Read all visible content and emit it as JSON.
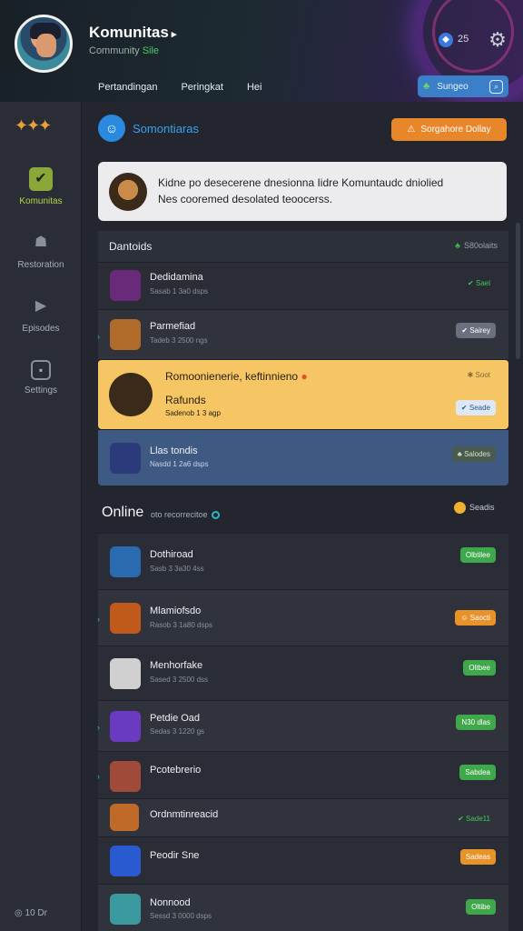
{
  "header": {
    "title": "Komunitas",
    "title_suffix": "▸",
    "subtitle": "Community",
    "subtitle_highlight": "Sile",
    "coin_count": "25",
    "tabs": [
      "Pertandingan",
      "Peringkat",
      "Hei"
    ],
    "search_label": "Sungeo"
  },
  "sidebar": {
    "items": [
      {
        "label": "Komunitas",
        "icon": "check-icon"
      },
      {
        "label": "Restoration",
        "icon": "person-icon"
      },
      {
        "label": "Episodes",
        "icon": "play-icon"
      },
      {
        "label": "Settings",
        "icon": "box-icon"
      }
    ],
    "footer": "10   Dr"
  },
  "community": {
    "title": "Somontiaras",
    "action_label": "Sorgahore Dollay"
  },
  "notice": {
    "line1": "Kidne po desecerene dnesionna Iidre Komuntaudc dniolied",
    "line2": "Nes cooremed desolated teoocerss."
  },
  "featured": {
    "title": "Dantoids",
    "right": "S80olaits",
    "rows": [
      {
        "name": "Dedidamina",
        "meta": "Sasab 1 3a0 dsps",
        "badge": "Sael",
        "badge_style": "green-soft",
        "thumb_color": "#6a2a7a"
      },
      {
        "name": "Parmefiad",
        "meta": "Tadeb 3 2500 ngs",
        "badge": "Sairey",
        "badge_style": "gray",
        "thumb_color": "#b06a2a"
      },
      {
        "name": "Rafunds",
        "title_line": "Romoonienerie, keftinnieno",
        "meta": "Sadenob 1 3 agp",
        "badge": "Seade",
        "badge_style": "light",
        "top_badge": "Soot",
        "thumb_color": "#3a2a1a"
      },
      {
        "name": "Llas tondis",
        "meta": "Nasdd 1 2a6 dsps",
        "badge": "Salodes",
        "badge_style": "dark",
        "thumb_color": "#2a3a7a"
      }
    ]
  },
  "online": {
    "title": "Online",
    "subtitle": "oto recorrecitoe",
    "right": "Seadis",
    "rows": [
      {
        "name": "Dothiroad",
        "meta": "Sasb 3 3a30 4ss",
        "badge": "Olbtilee",
        "badge_style": "green",
        "thumb_color": "#2a6ab0"
      },
      {
        "name": "Mlamiofsdo",
        "meta": "Rasob 3 1a80 dsps",
        "badge": "Saocti",
        "badge_style": "orange",
        "thumb_color": "#c05a1a"
      },
      {
        "name": "Menhorfake",
        "meta": "Sased 3 2500 dss",
        "badge": "Oltbee",
        "badge_style": "green",
        "thumb_color": "#d0d0d0"
      },
      {
        "name": "Petdie Oad",
        "meta": "Sedas 3 1220 gs",
        "badge": "N30 dlas",
        "badge_style": "green",
        "thumb_color": "#6a3ac0"
      },
      {
        "name": "Pcotebrerio",
        "meta": "",
        "badge": "Sabdea",
        "badge_style": "green",
        "thumb_color": "#a04a3a"
      },
      {
        "name": "Ordnmtinreacid",
        "meta": "",
        "badge": "Sade11",
        "badge_style": "green-soft",
        "thumb_color": "#c06a2a"
      },
      {
        "name": "Peodir Sne",
        "meta": "",
        "badge": "Sadeas",
        "badge_style": "orange",
        "thumb_color": "#2a5ad0"
      },
      {
        "name": "Nonnood",
        "meta": "Sessd 3 0000 dsps",
        "badge": "Oltibe",
        "badge_style": "green",
        "thumb_color": "#3a9aa0"
      }
    ]
  },
  "colors": {
    "accent_blue": "#3aa0f0",
    "accent_orange": "#e8862a",
    "accent_green": "#3ea84a",
    "highlight_row": "#f6c664"
  }
}
